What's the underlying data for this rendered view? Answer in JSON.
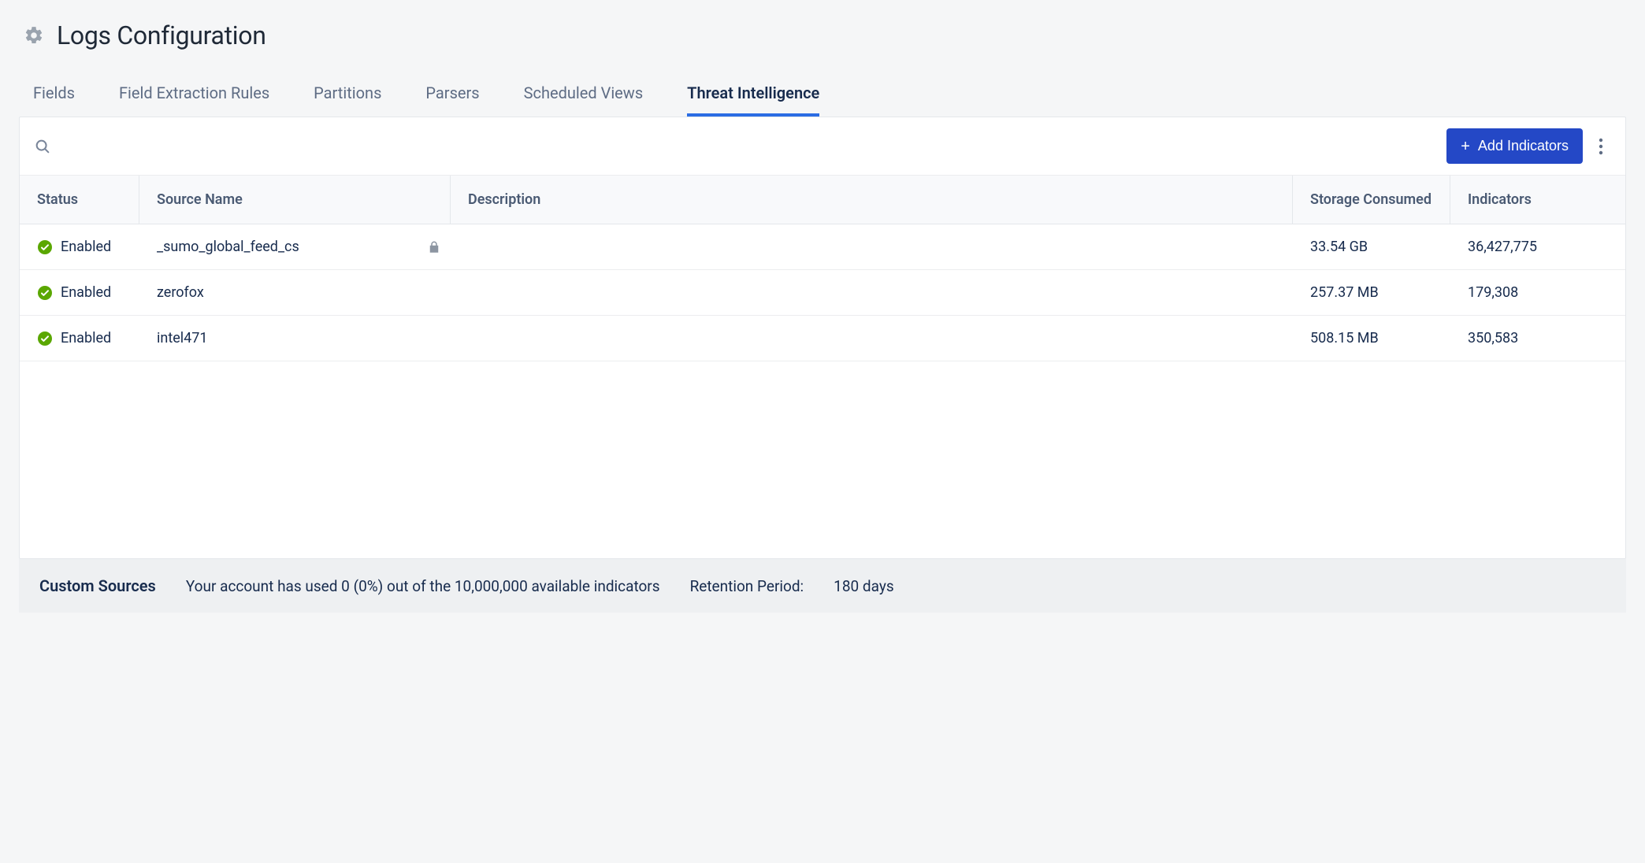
{
  "header": {
    "title": "Logs Configuration"
  },
  "tabs": {
    "items": [
      {
        "label": "Fields",
        "active": false
      },
      {
        "label": "Field Extraction Rules",
        "active": false
      },
      {
        "label": "Partitions",
        "active": false
      },
      {
        "label": "Parsers",
        "active": false
      },
      {
        "label": "Scheduled Views",
        "active": false
      },
      {
        "label": "Threat Intelligence",
        "active": true
      }
    ]
  },
  "toolbar": {
    "add_label": "Add Indicators"
  },
  "table": {
    "columns": {
      "status": "Status",
      "source": "Source Name",
      "description": "Description",
      "storage": "Storage Consumed",
      "indicators": "Indicators"
    },
    "rows": [
      {
        "status": "Enabled",
        "source": "_sumo_global_feed_cs",
        "locked": true,
        "description": "",
        "storage": "33.54 GB",
        "indicators": "36,427,775"
      },
      {
        "status": "Enabled",
        "source": "zerofox",
        "locked": false,
        "description": "",
        "storage": "257.37 MB",
        "indicators": "179,308"
      },
      {
        "status": "Enabled",
        "source": "intel471",
        "locked": false,
        "description": "",
        "storage": "508.15 MB",
        "indicators": "350,583"
      }
    ]
  },
  "footer": {
    "title": "Custom Sources",
    "usage": "Your account has used 0 (0%) out of the 10,000,000 available indicators",
    "retention_label": "Retention Period:",
    "retention_value": "180 days"
  }
}
